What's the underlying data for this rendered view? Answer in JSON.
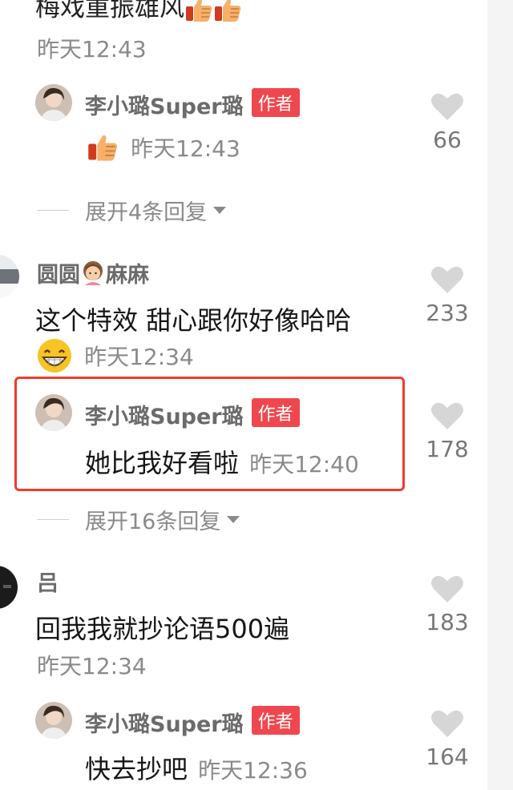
{
  "top_comment": {
    "text": "梅戏重振雄风",
    "time": "昨天12:43"
  },
  "replies": [
    {
      "name": "李小璐Super璐",
      "badge": "作者",
      "text": "",
      "time": "昨天12:43",
      "likes": "66"
    },
    {
      "name": "李小璐Super璐",
      "badge": "作者",
      "text": "她比我好看啦",
      "time": "昨天12:40",
      "likes": "178"
    },
    {
      "name": "李小璐Super璐",
      "badge": "作者",
      "text": "快去抄吧",
      "time": "昨天12:36",
      "likes": "164"
    }
  ],
  "comments": [
    {
      "name_part1": "圆圆",
      "name_part2": "麻麻",
      "text": "这个特效 甜心跟你好像哈哈",
      "time": "昨天12:34",
      "likes": "233"
    },
    {
      "name": "吕",
      "text": "回我我就抄论语500遍",
      "time": "昨天12:34",
      "likes": "183"
    }
  ],
  "expand": [
    {
      "label": "展开4条回复"
    },
    {
      "label": "展开16条回复"
    }
  ],
  "colors": {
    "badge": "#f0474e",
    "highlight": "#f03b2c",
    "muted": "#8a8a8a"
  },
  "icons": [
    "thumbs-up-icon",
    "heart-icon",
    "grin-icon",
    "girl-face-icon",
    "chevron-down-icon"
  ]
}
